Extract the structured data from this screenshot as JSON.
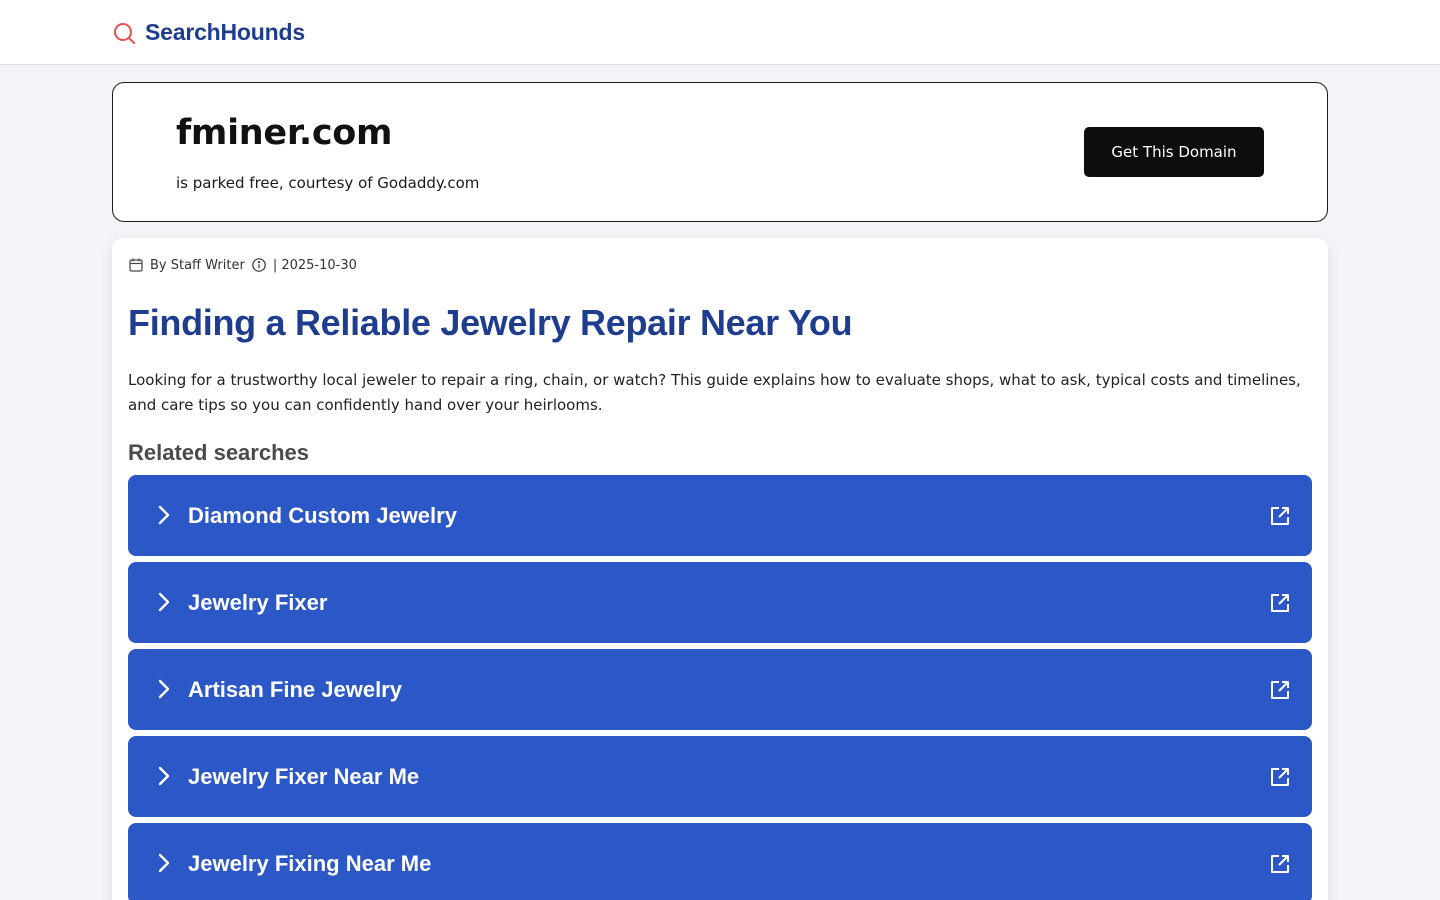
{
  "header": {
    "brand": "SearchHounds"
  },
  "domain_banner": {
    "domain": "fminer.com",
    "subtitle": "is parked free, courtesy of Godaddy.com",
    "cta_label": "Get This Domain"
  },
  "article": {
    "author": "By Staff Writer",
    "date": "| 2025-10-30",
    "title": "Finding a Reliable Jewelry Repair Near You",
    "intro": "Looking for a trustworthy local jeweler to repair a ring, chain, or watch? This guide explains how to evaluate shops, what to ask, typical costs and timelines, and care tips so you can confidently hand over your heirlooms."
  },
  "related": {
    "heading": "Related searches",
    "items": [
      {
        "label": "Diamond Custom Jewelry"
      },
      {
        "label": "Jewelry Fixer"
      },
      {
        "label": "Artisan Fine Jewelry"
      },
      {
        "label": "Jewelry Fixer Near Me"
      },
      {
        "label": "Jewelry Fixing Near Me"
      }
    ]
  },
  "colors": {
    "brand": "#1f3d8f",
    "brand_icon": "#e5534b",
    "search_item_bg": "#2b57c7",
    "cta_bg": "#0d0d0d"
  },
  "icons": {
    "brand": "search-icon",
    "meta_date": "calendar-icon",
    "meta_info": "info-icon",
    "item_lead": "chevron-right-icon",
    "item_trail": "external-link-icon"
  }
}
